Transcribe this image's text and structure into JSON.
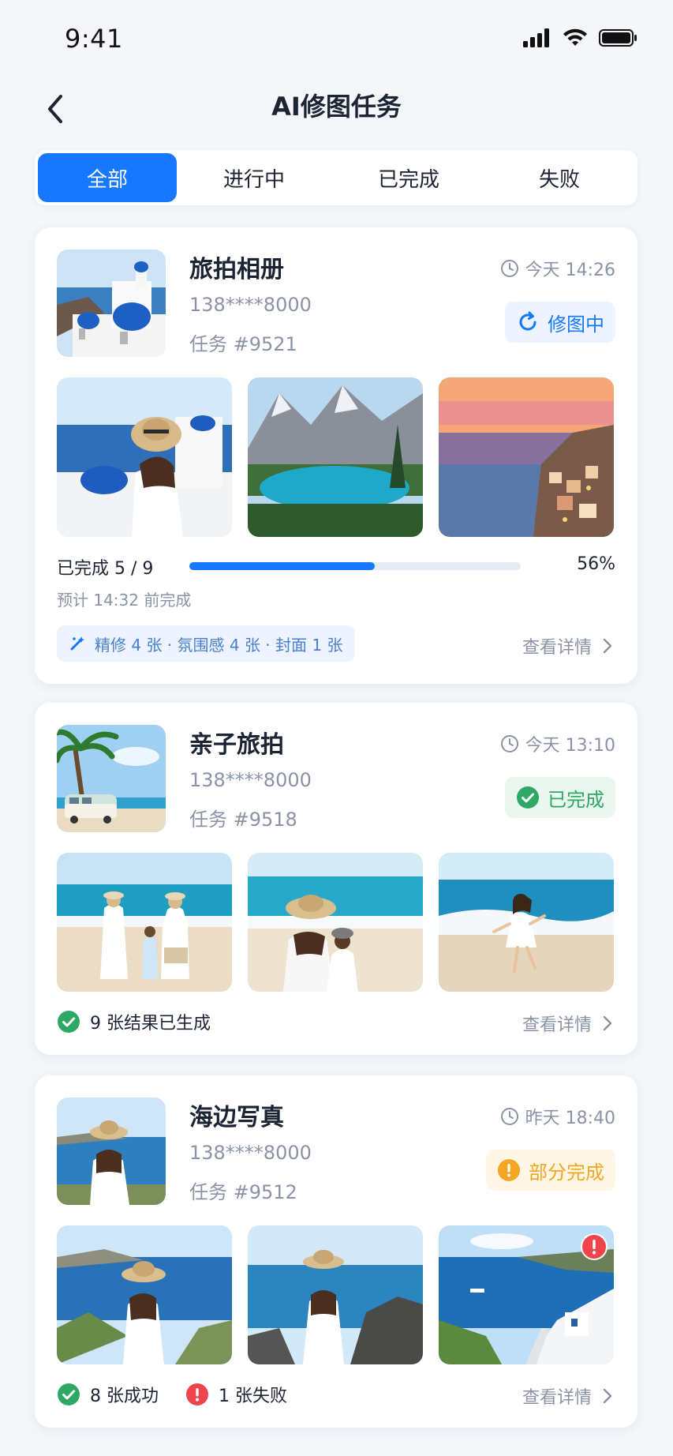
{
  "status_bar": {
    "time": "9:41"
  },
  "nav": {
    "title": "AI修图任务"
  },
  "tabs": [
    {
      "label": "全部",
      "active": true
    },
    {
      "label": "进行中",
      "active": false
    },
    {
      "label": "已完成",
      "active": false
    },
    {
      "label": "失败",
      "active": false
    }
  ],
  "tasks": [
    {
      "title": "旅拍相册",
      "phone": "138****8000",
      "task_id": "任务 #9521",
      "time": "今天 14:26",
      "status_label": "修图中",
      "status_icon": "refresh-icon",
      "progress_label": "已完成 5 / 9",
      "progress_fraction": 0.56,
      "progress_percent": "56%",
      "eta": "预计 14:32 前完成",
      "tags": "精修 4 张 · 氛围感 4 张 · 封面 1 张",
      "detail_label": "查看详情"
    },
    {
      "title": "亲子旅拍",
      "phone": "138****8000",
      "task_id": "任务 #9518",
      "time": "今天 13:10",
      "status_label": "已完成",
      "status_icon": "check-circle-icon",
      "summary": "9 张结果已生成",
      "detail_label": "查看详情"
    },
    {
      "title": "海边写真",
      "phone": "138****8000",
      "task_id": "任务 #9512",
      "time": "昨天 18:40",
      "status_label": "部分完成",
      "status_icon": "warning-circle-icon",
      "success_label": "8 张成功",
      "fail_label": "1 张失败",
      "detail_label": "查看详情"
    }
  ],
  "colors": {
    "accent": "#1677ff",
    "success": "#2fa866",
    "warning": "#f5a623",
    "error": "#f0454d",
    "background": "#f4f6fa"
  }
}
